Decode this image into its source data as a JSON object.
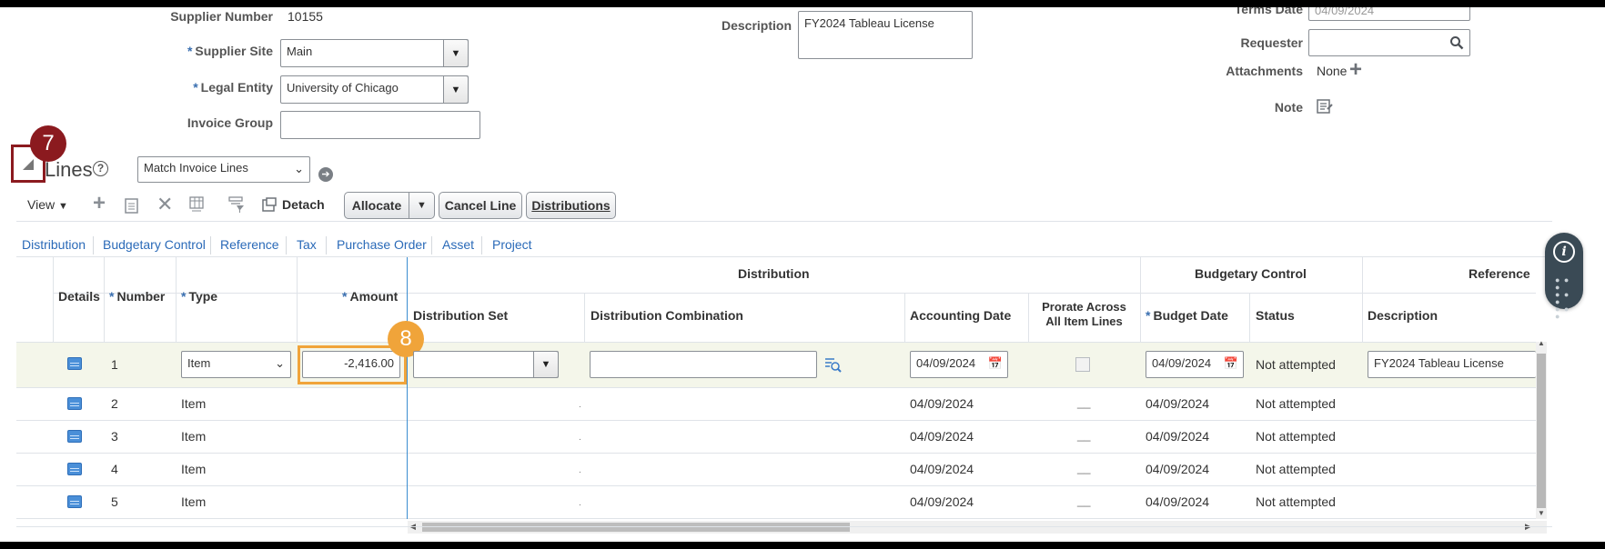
{
  "header": {
    "supplier_number_label": "Supplier Number",
    "supplier_number": "10155",
    "supplier_site_label": "Supplier Site",
    "supplier_site": "Main",
    "legal_entity_label": "Legal Entity",
    "legal_entity": "University of Chicago",
    "invoice_group_label": "Invoice Group",
    "invoice_group": "",
    "description_label": "Description",
    "description": "FY2024 Tableau License",
    "terms_date_label": "Terms Date",
    "terms_date": "04/09/2024",
    "requester_label": "Requester",
    "requester": "",
    "attachments_label": "Attachments",
    "attachments_value": "None",
    "note_label": "Note"
  },
  "lines": {
    "title": "Lines",
    "action_select": "Match Invoice Lines",
    "view_label": "View",
    "detach_label": "Detach",
    "allocate_label": "Allocate",
    "cancel_line_label": "Cancel Line",
    "distributions_label": "Distributions",
    "tabs": [
      "Distribution",
      "Budgetary Control",
      "Reference",
      "Tax",
      "Purchase Order",
      "Asset",
      "Project"
    ],
    "group_headers": {
      "distribution": "Distribution",
      "budgetary": "Budgetary Control",
      "reference": "Reference"
    },
    "columns": {
      "details": "Details",
      "number": "Number",
      "type": "Type",
      "amount": "Amount",
      "distribution_set": "Distribution Set",
      "distribution_combination": "Distribution Combination",
      "accounting_date": "Accounting Date",
      "prorate_line1": "Prorate Across",
      "prorate_line2": "All Item Lines",
      "budget_date": "Budget Date",
      "status": "Status",
      "description": "Description"
    },
    "rows": [
      {
        "number": "1",
        "type": "Item",
        "amount": "-2,416.00",
        "accounting_date": "04/09/2024",
        "budget_date": "04/09/2024",
        "status": "Not attempted",
        "description": "FY2024 Tableau License"
      },
      {
        "number": "2",
        "type": "Item",
        "amount": "",
        "accounting_date": "04/09/2024",
        "budget_date": "04/09/2024",
        "status": "Not attempted",
        "description": ""
      },
      {
        "number": "3",
        "type": "Item",
        "amount": "",
        "accounting_date": "04/09/2024",
        "budget_date": "04/09/2024",
        "status": "Not attempted",
        "description": ""
      },
      {
        "number": "4",
        "type": "Item",
        "amount": "",
        "accounting_date": "04/09/2024",
        "budget_date": "04/09/2024",
        "status": "Not attempted",
        "description": ""
      },
      {
        "number": "5",
        "type": "Item",
        "amount": "",
        "accounting_date": "04/09/2024",
        "budget_date": "04/09/2024",
        "status": "Not attempted",
        "description": ""
      }
    ]
  },
  "annotations": {
    "step7": "7",
    "step8": "8"
  },
  "colors": {
    "accent": "#2a6ab8",
    "step7": "#8b1a1f",
    "step8": "#f0a43a"
  }
}
